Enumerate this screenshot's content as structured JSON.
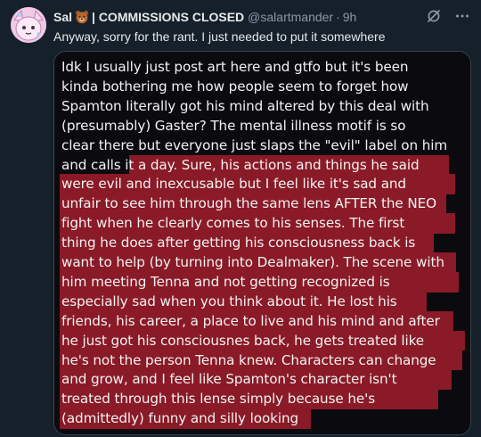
{
  "author": {
    "display_name": "Sal",
    "name_suffix": "| COMMISSIONS CLOSED",
    "handle": "@salartmander",
    "separator": "·",
    "time": "9h"
  },
  "icons": {
    "avatar": "avatar-image",
    "badge": "bear-emoji-icon",
    "grok": "grok-icon",
    "more": "more-icon"
  },
  "tweet_text": "Anyway, sorry for the rant. I just needed to put it somewhere",
  "attachment": {
    "lines": [
      "Idk I usually just post art here and gtfo but it's been",
      "kinda bothering me how people seem to forget how",
      "Spamton literally got his mind altered by this deal with",
      "(presumably) Gaster? The mental illness motif is so",
      "clear there but everyone just slaps the \"evil\" label on him",
      "and calls it a day. Sure, his actions and things he said",
      "were evil and inexcusable but I feel like it's sad and",
      "unfair to see him through the same lens AFTER the NEO",
      "fight when he clearly comes to his senses. The first",
      "thing he does after getting his consciousness back is",
      "want to help (by turning into Dealmaker). The scene with",
      "him meeting Tenna and not getting recognized is",
      "especially sad when you think about it. He lost his",
      "friends, his career, a place to live and his mind and after",
      "he just got his consciousnes back, he gets treated like",
      "he's not the person Tenna knew. Characters can change",
      "and grow, and I feel like Spamton's character isn't",
      "treated through this lense simply because he's",
      "(admittedly) funny and silly looking"
    ],
    "highlight_color": "#8a1a27",
    "background_color": "#0b0b0f",
    "text_color": "#f2f2f2"
  },
  "colors": {
    "page_bg": "#15202b",
    "primary_text": "#e7e9ea",
    "secondary_text": "#8b98a5",
    "border": "#38444d"
  }
}
